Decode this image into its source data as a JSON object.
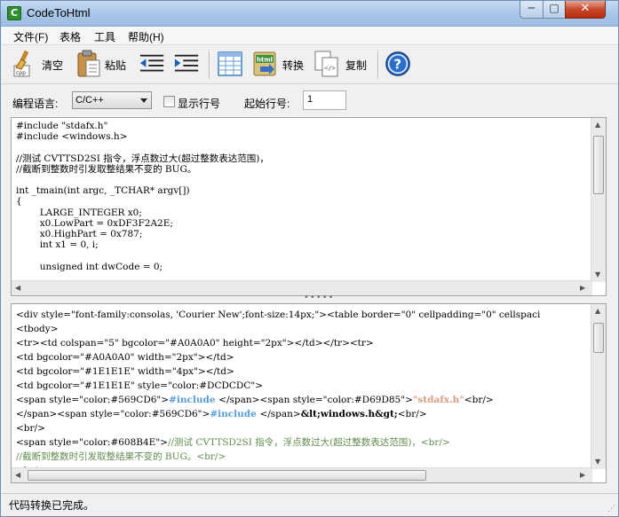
{
  "window": {
    "title": "CodeToHtml",
    "app_icon_letter": "C",
    "min_glyph": "─",
    "max_glyph": "□",
    "close_glyph": "✕"
  },
  "menu": [
    "文件(F)",
    "表格",
    "工具",
    "帮助(H)"
  ],
  "toolbar": {
    "clear_label": "清空",
    "paste_label": "粘贴",
    "convert_label": "转换",
    "copy_label": "复制",
    "help_glyph": "?",
    "html_icon_text": "html"
  },
  "options": {
    "language_label": "编程语言:",
    "language_value": "C/C++",
    "show_line_numbers_label": "显示行号",
    "start_line_label": "起始行号:",
    "start_line_value": "1"
  },
  "source_lines": [
    "#include \"stdafx.h\"",
    "#include <windows.h>",
    "",
    "//测试 CVTTSD2SI 指令，浮点数过大(超过整数表达范围)，",
    "//截断到整数时引发取整结果不变的 BUG。",
    "",
    "int _tmain(int argc, _TCHAR* argv[])",
    "{",
    "        LARGE_INTEGER x0;",
    "        x0.LowPart = 0xDF3F2A2E;",
    "        x0.HighPart = 0x787;",
    "        int x1 = 0, i;",
    "",
    "        unsigned int dwCode = 0;"
  ],
  "html_output": {
    "line1": "<div style=\"font-family:consolas, 'Courier New';font-size:14px;\"><table border=\"0\" cellpadding=\"0\" cellspaci",
    "line2": "<tbody>",
    "line3": "<tr><td colspan=\"5\" bgcolor=\"#A0A0A0\" height=\"2px\"></td></tr><tr>",
    "line4": "<td bgcolor=\"#A0A0A0\" width=\"2px\"></td>",
    "line5": "<td bgcolor=\"#1E1E1E\" width=\"4px\"></td>",
    "line6": "<td bgcolor=\"#1E1E1E\" style=\"color:#DCDCDC\">",
    "line7_a": "<span style=\"color:#569CD6\">",
    "line7_b": "#include ",
    "line7_c": "</span><span style=\"color:#D69D85\">",
    "line7_d": "\"stdafx.h\"",
    "line7_e": "<br/>",
    "line8_a": "</span><span style=\"color:#569CD6\">",
    "line8_b": "#include ",
    "line8_c": "</span>",
    "line8_d": "&lt;windows.h&gt;",
    "line8_e": "<br/>",
    "line9": "<br/>",
    "line10_a": "<span style=\"color:#608B4E\">",
    "line10_b": "//测试 CVTTSD2SI 指令，浮点数过大(超过整数表达范围)，<br/>",
    "line11": "//截断到整数时引发取整结果不变的 BUG。<br/>",
    "line12": "<br/>"
  },
  "splitter_glyph": "•••••",
  "scroll_glyphs": {
    "up": "▲",
    "down": "▼",
    "left": "◀",
    "right": "▶",
    "grip": "⋰"
  },
  "status": "代码转换已完成。",
  "colors": {
    "keyword": "#569CD6",
    "string": "#D69D85",
    "comment": "#608B4E"
  }
}
